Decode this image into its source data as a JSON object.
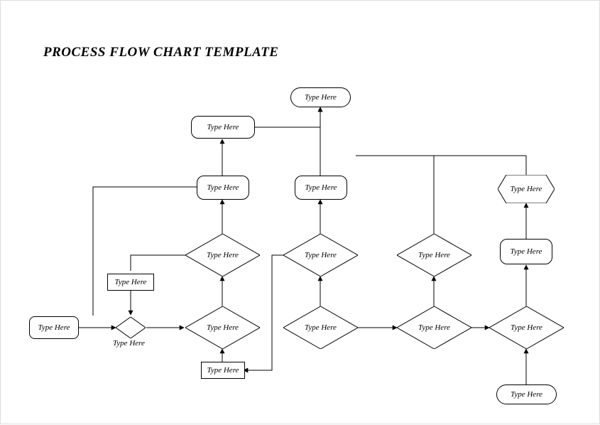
{
  "title": "PROCESS FLOW CHART TEMPLATE",
  "placeholder": "Type Here",
  "nodes": {
    "terminator_top": "Type Here",
    "process_top_wide": "Type Here",
    "process_mid_1": "Type Here",
    "process_mid_2": "Type Here",
    "hex_right": "Type Here",
    "decision_col1_a": "Type Here",
    "decision_col2_a": "Type Here",
    "decision_col3_a": "Type Here",
    "process_right_mid": "Type Here",
    "rect_small_left": "Type Here",
    "decision_col1_b": "Type Here",
    "decision_col2_b": "Type Here",
    "decision_col3_b": "Type Here",
    "decision_col4_b": "Type Here",
    "terminator_left": "Type Here",
    "small_diamond": "Type Here",
    "rect_small_bottom": "Type Here",
    "terminator_bottom_right": "Type Here"
  }
}
